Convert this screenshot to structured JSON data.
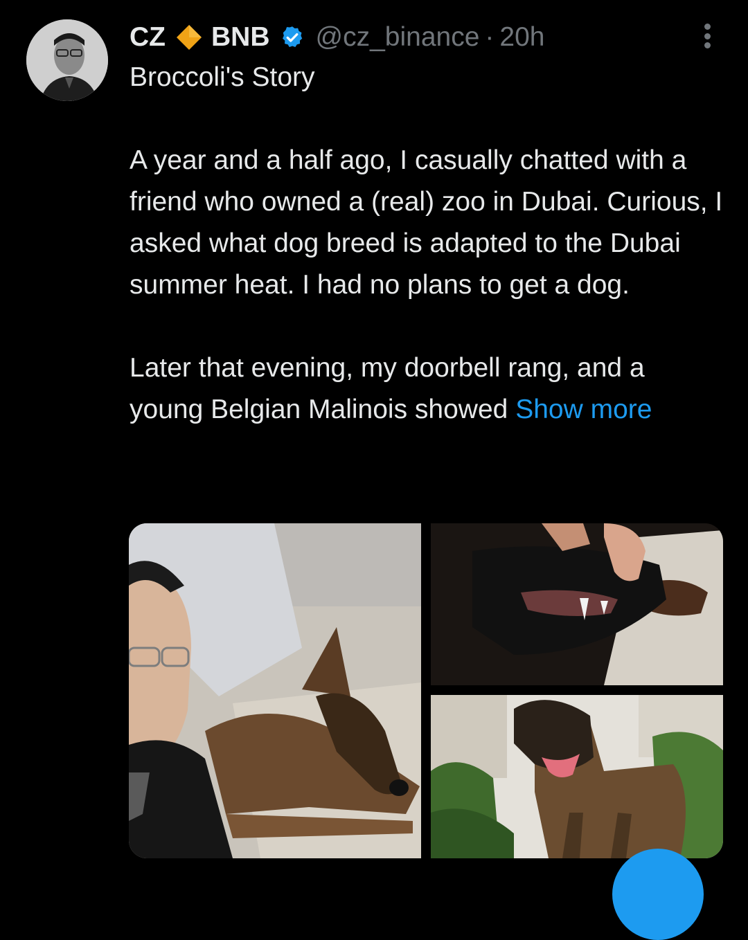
{
  "tweet": {
    "author_name": "CZ",
    "author_suffix": "BNB",
    "handle": "@cz_binance",
    "separator": "·",
    "time": "20h",
    "title_line": "Broccoli's Story",
    "paragraph_1": "A year and a half ago, I casually chatted with a friend who owned a (real) zoo in Dubai. Curious, I asked what dog breed is adapted to the Dubai summer heat. I had no plans to get a dog.",
    "paragraph_2": "Later that evening, my doorbell rang, and a young Belgian Malinois showed",
    "show_more": "Show more"
  },
  "colors": {
    "background": "#000000",
    "text": "#e7e9ea",
    "muted": "#71767b",
    "link": "#1d9bf0",
    "verified": "#1d9bf0",
    "diamond": "#f0a316"
  },
  "icons": {
    "diamond": "orange-diamond-icon",
    "verified": "verified-badge-icon",
    "more": "more-options-icon"
  },
  "media": {
    "count": 3,
    "photos": [
      "selfie with young Belgian Malinois on sofa",
      "close-up of puppy teeth",
      "grown Belgian Malinois standing in garden"
    ]
  }
}
